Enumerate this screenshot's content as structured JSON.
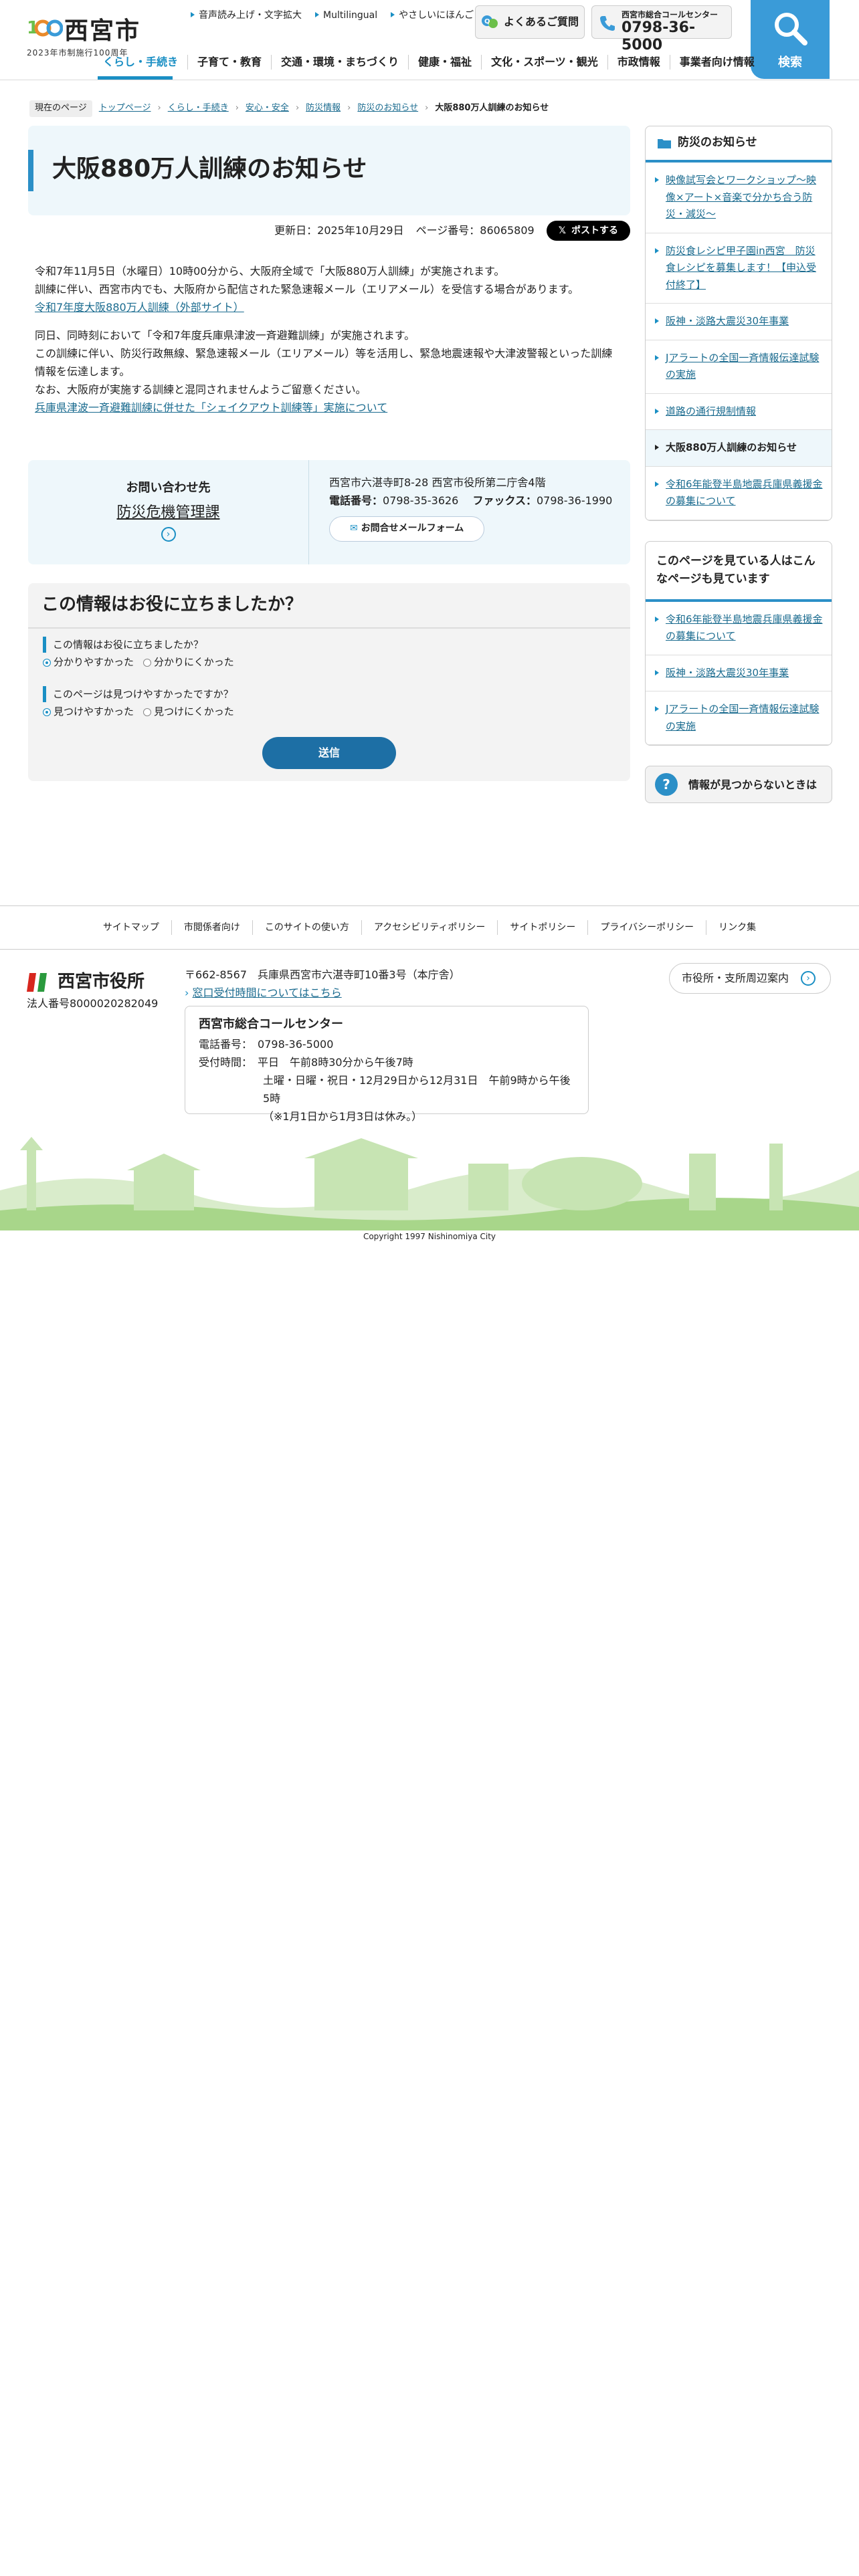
{
  "header": {
    "city_name": "西宮市",
    "anniversary": "2023年市制施行100周年",
    "util_links": [
      "音声読み上げ・文字拡大",
      "Multilingual",
      "やさしいにほんご"
    ],
    "faq_label": "よくあるご質問",
    "call_center_label": "西宮市総合コールセンター",
    "call_center_number": "0798-36-5000",
    "search_label": "検索"
  },
  "gnav": [
    "くらし・手続き",
    "子育て・教育",
    "交通・環境・まちづくり",
    "健康・福祉",
    "文化・スポーツ・観光",
    "市政情報",
    "事業者向け情報"
  ],
  "breadcrumb": {
    "here": "現在のページ",
    "items": [
      "トップページ",
      "くらし・手続き",
      "安心・安全",
      "防災情報",
      "防災のお知らせ"
    ],
    "current": "大阪880万人訓練のお知らせ"
  },
  "article": {
    "title": "大阪880万人訓練のお知らせ",
    "updated": "更新日：2025年10月29日",
    "page_no": "ページ番号：86065809",
    "post_label": "ポストする",
    "p1_line1": "令和7年11月5日（水曜日）10時00分から、大阪府全域で「大阪880万人訓練」が実施されます。",
    "p1_line2": "訓練に伴い、西宮市内でも、大阪府から配信された緊急速報メール（エリアメール）を受信する場合があります。",
    "p1_link": "令和7年度大阪880万人訓練（外部サイト）",
    "p2_line1": "同日、同時刻において「令和7年度兵庫県津波一斉避難訓練」が実施されます。",
    "p2_line2": "この訓練に伴い、防災行政無線、緊急速報メール（エリアメール）等を活用し、緊急地震速報や大津波警報といった訓練",
    "p2_line3": "情報を伝達します。",
    "p2_line4": "なお、大阪府が実施する訓練と混同されませんようご留意ください。",
    "p2_link": "兵庫県津波一斉避難訓練に併せた「シェイクアウト訓練等」実施について"
  },
  "contact": {
    "label": "お問い合わせ先",
    "dept": "防災危機管理課",
    "address": "西宮市六湛寺町8-28 西宮市役所第二庁舎4階",
    "phone_label": "電話番号：",
    "phone": "0798-35-3626",
    "fax_label": "ファックス：",
    "fax": "0798-36-1990",
    "mail_label": "お問合せメールフォーム"
  },
  "survey": {
    "title": "この情報はお役に立ちましたか？",
    "q1": "この情報はお役に立ちましたか？",
    "q1_opts": [
      "分かりやすかった",
      "分かりにくかった"
    ],
    "q2": "このページは見つけやすかったですか？",
    "q2_opts": [
      "見つけやすかった",
      "見つけにくかった"
    ],
    "submit": "送信"
  },
  "sidebar": {
    "head": "防災のお知らせ",
    "items": [
      "映像試写会とワークショップ～映像×アート×音楽で分かち合う防災・減災～",
      "防災食レシピ甲子園in西宮　防災食レシピを募集します！【申込受付終了】",
      "阪神・淡路大震災30年事業",
      "Jアラートの全国一斉情報伝達試験の実施",
      "道路の通行規制情報",
      "大阪880万人訓練のお知らせ",
      "令和6年能登半島地震兵庫県義援金の募集について"
    ],
    "head2": "このページを見ている人はこんなページも見ています",
    "items2": [
      "令和6年能登半島地震兵庫県義援金の募集について",
      "阪神・淡路大震災30年事業",
      "Jアラートの全国一斉情報伝達試験の実施"
    ],
    "notfound": "情報が見つからないときは"
  },
  "footer": {
    "links": [
      "サイトマップ",
      "市閲係者向け",
      "このサイトの使い方",
      "アクセシビリティポリシー",
      "サイトポリシー",
      "プライバシーポリシー",
      "リンク集"
    ],
    "org": "西宮市役所",
    "corp_no": "法人番号8000020282049",
    "address": "〒662-8567　兵庫県西宮市六湛寺町10番3号（本庁舎）",
    "hours_link": "窓口受付時間についてはこちら",
    "cc_title": "西宮市総合コールセンター",
    "cc_phone_label": "電話番号：",
    "cc_phone": "0798-36-5000",
    "cc_hours_label": "受付時間：",
    "cc_hours1": "平日　午前8時30分から午後7時",
    "cc_hours2": "土曜・日曜・祝日・12月29日から12月31日　午前9時から午後5時",
    "cc_hours3": "（※1月1日から1月3日は休み。）",
    "guide": "市役所・支所周辺案内",
    "copyright": "Copyright 1997 Nishinomiya City"
  },
  "colors": {
    "accent": "#1a8fc4",
    "search_bg": "#3a9bd8",
    "submit": "#1d6fa5",
    "green": "#a8d68a"
  },
  "icons": [
    "speech-bubbles-icon",
    "phone-icon",
    "search-icon",
    "folder-icon",
    "question-icon",
    "x-logo-icon",
    "mail-icon",
    "chevron-right-icon"
  ]
}
